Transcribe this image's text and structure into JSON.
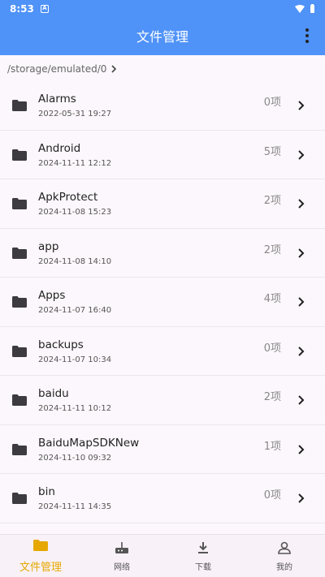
{
  "status_bar": {
    "time": "8:53",
    "badge": "A"
  },
  "app_bar": {
    "title": "文件管理"
  },
  "breadcrumb": {
    "path": "/storage/emulated/0"
  },
  "colors": {
    "primary": "#4f92f8",
    "active_tab": "#e6a800"
  },
  "files": [
    {
      "name": "Alarms",
      "date": "2022-05-31 19:27",
      "count": "0项"
    },
    {
      "name": "Android",
      "date": "2024-11-11 12:12",
      "count": "5项"
    },
    {
      "name": "ApkProtect",
      "date": "2024-11-08 15:23",
      "count": "2项"
    },
    {
      "name": "app",
      "date": "2024-11-08 14:10",
      "count": "2项"
    },
    {
      "name": "Apps",
      "date": "2024-11-07 16:40",
      "count": "4项"
    },
    {
      "name": "backups",
      "date": "2024-11-07 10:34",
      "count": "0项"
    },
    {
      "name": "baidu",
      "date": "2024-11-11 10:12",
      "count": "2项"
    },
    {
      "name": "BaiduMapSDKNew",
      "date": "2024-11-10 09:32",
      "count": "1项"
    },
    {
      "name": "bin",
      "date": "2024-11-11 14:35",
      "count": "0项"
    }
  ],
  "nav": [
    {
      "label": "文件管理",
      "icon": "folder-icon",
      "active": true
    },
    {
      "label": "网络",
      "icon": "router-icon",
      "active": false
    },
    {
      "label": "下载",
      "icon": "download-icon",
      "active": false
    },
    {
      "label": "我的",
      "icon": "person-icon",
      "active": false
    }
  ]
}
